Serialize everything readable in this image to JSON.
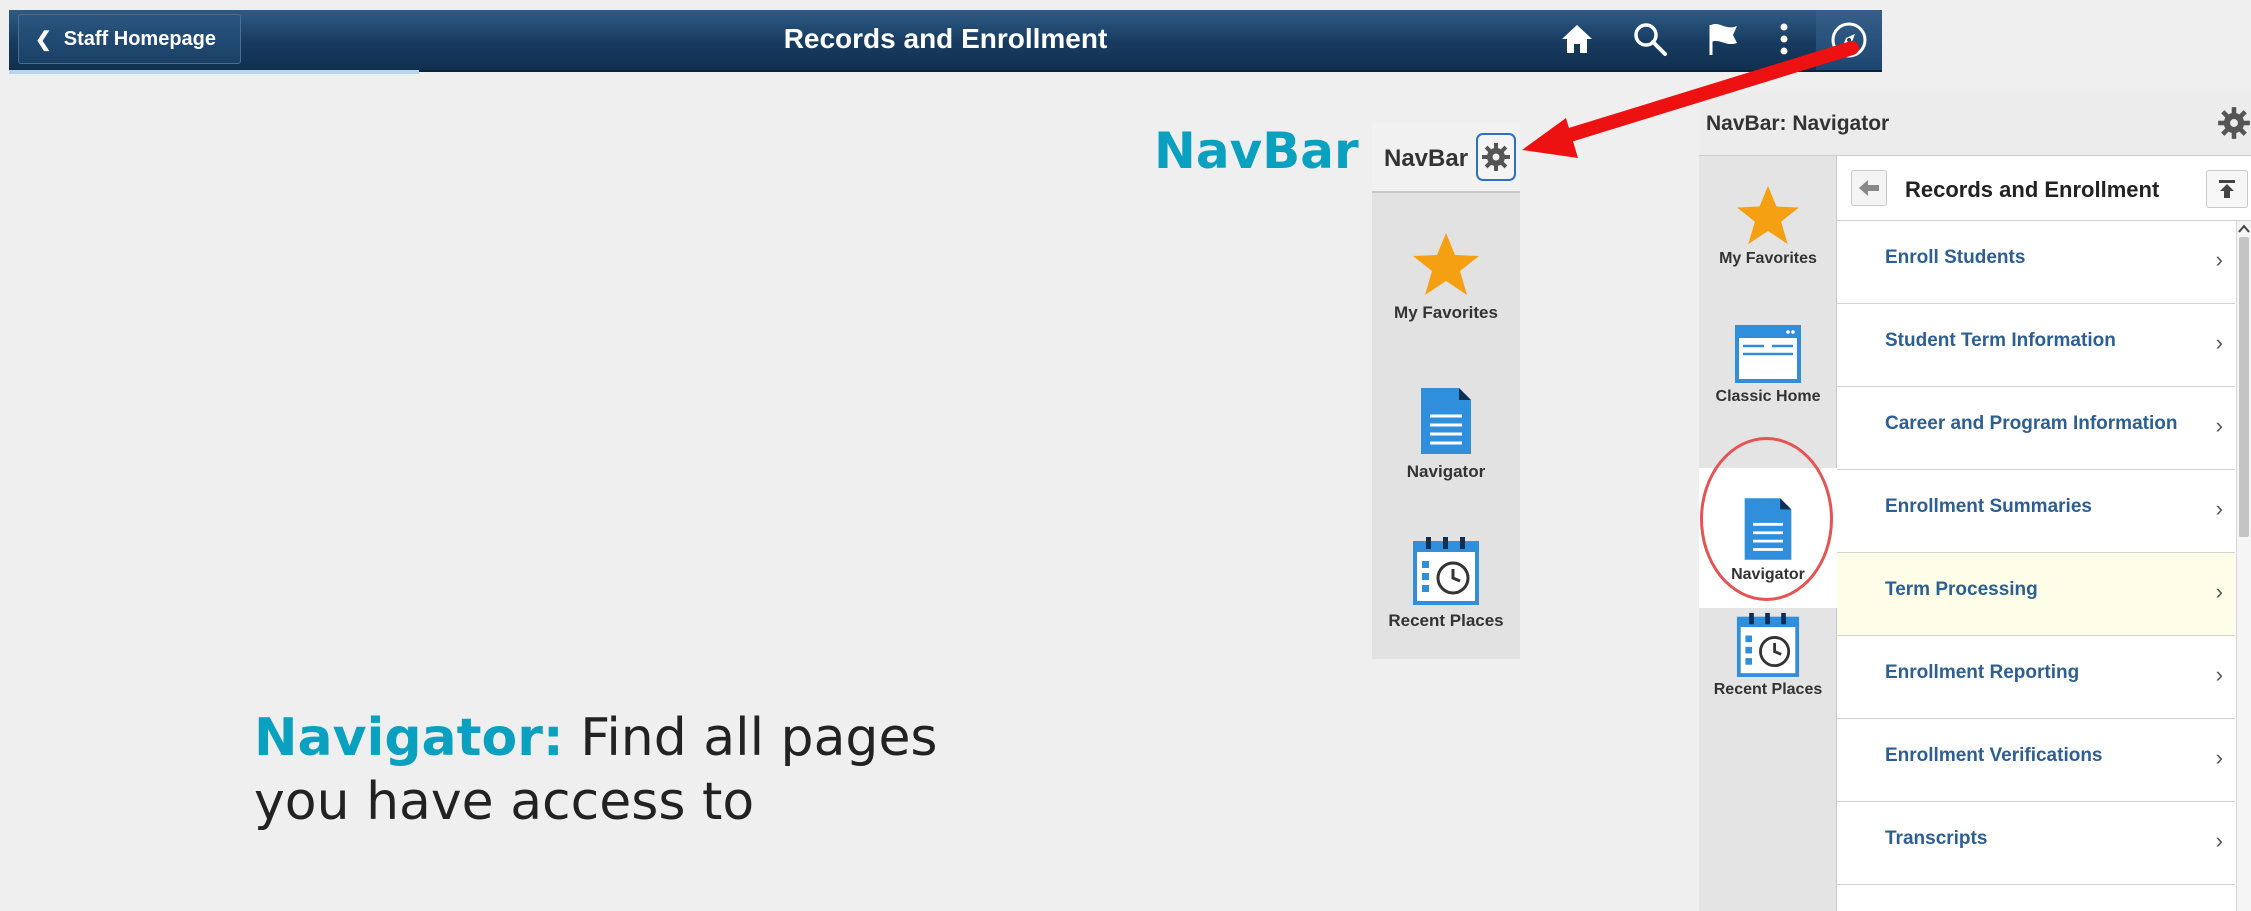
{
  "banner": {
    "back_label": "Staff Homepage",
    "title": "Records and Enrollment",
    "icons": [
      "home-icon",
      "search-icon",
      "flag-icon",
      "more-icon",
      "navbar-compass-icon"
    ]
  },
  "captions": {
    "navbar": "NavBar",
    "navigator_bold": "Navigator:",
    "navigator_line1": " Find all pages",
    "navigator_line2": "you have access to"
  },
  "small_navbar": {
    "title": "NavBar",
    "tiles": [
      {
        "label": "My Favorites",
        "icon": "star-icon"
      },
      {
        "label": "Navigator",
        "icon": "document-icon"
      },
      {
        "label": "Recent Places",
        "icon": "calendar-clock-icon"
      }
    ]
  },
  "navigator_panel": {
    "title": "NavBar: Navigator",
    "rail": [
      {
        "label": "My Favorites",
        "icon": "star-icon"
      },
      {
        "label": "Classic Home",
        "icon": "window-icon"
      },
      {
        "label": "Navigator",
        "icon": "document-icon",
        "active": true
      },
      {
        "label": "Recent Places",
        "icon": "calendar-clock-icon"
      }
    ],
    "folder_title": "Records and Enrollment",
    "items": [
      {
        "label": "Enroll Students"
      },
      {
        "label": "Student Term Information"
      },
      {
        "label": "Career and Program Information"
      },
      {
        "label": "Enrollment Summaries"
      },
      {
        "label": "Term Processing",
        "highlighted": true
      },
      {
        "label": "Enrollment Reporting"
      },
      {
        "label": "Enrollment Verifications"
      },
      {
        "label": "Transcripts"
      }
    ]
  },
  "colors": {
    "banner": "#1c4670",
    "accent_caption": "#0aa0bf",
    "link": "#2d5f93",
    "star": "#f5a012",
    "doc": "#2f8fdc",
    "arrow": "#ee1111"
  }
}
